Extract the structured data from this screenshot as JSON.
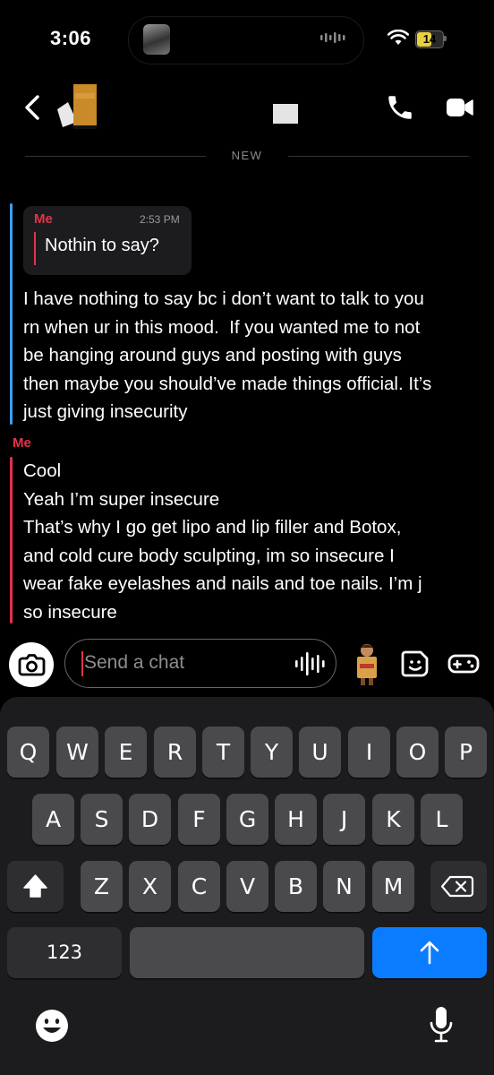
{
  "status_bar": {
    "time": "3:06",
    "battery": "14"
  },
  "header": {
    "new_label": "NEW"
  },
  "conversation": {
    "quoted": {
      "sender": "Me",
      "time": "2:53 PM",
      "text": "Nothin to say?"
    },
    "reply_lines": [
      "I have nothing to say bc i don’t want to talk to you",
      "rn when ur in this mood.  If you wanted me to not",
      "be hanging around guys and posting with guys",
      "then maybe you should’ve made things official. It’s",
      "just giving insecurity"
    ],
    "me_label": "Me",
    "me_lines": [
      "Cool",
      "Yeah I’m super insecure",
      "That’s why I go get lipo and lip filler and Botox,",
      "and cold cure body sculpting, im so insecure I",
      "wear fake eyelashes and nails and toe nails. I’m j",
      "so insecure"
    ]
  },
  "composer": {
    "placeholder": "Send a chat"
  },
  "keyboard": {
    "row1": [
      "Q",
      "W",
      "E",
      "R",
      "T",
      "Y",
      "U",
      "I",
      "O",
      "P"
    ],
    "row2": [
      "A",
      "S",
      "D",
      "F",
      "G",
      "H",
      "J",
      "K",
      "L"
    ],
    "row3": [
      "Z",
      "X",
      "C",
      "V",
      "B",
      "N",
      "M"
    ],
    "numbers_key": "123"
  },
  "colors": {
    "accent_red": "#e3334a",
    "accent_blue": "#3aa0f0",
    "send_blue": "#0a7cff",
    "battery_yellow": "#e8d040"
  },
  "icons": {
    "back": "chevron-left-icon",
    "call": "phone-icon",
    "video": "video-camera-icon",
    "camera": "camera-icon",
    "voice": "voice-wave-icon",
    "sticker": "sticker-icon",
    "games": "gamepad-icon",
    "shift": "shift-arrow-icon",
    "delete": "backspace-icon",
    "send": "arrow-up-icon",
    "emoji": "emoji-icon",
    "dictation": "microphone-icon"
  }
}
